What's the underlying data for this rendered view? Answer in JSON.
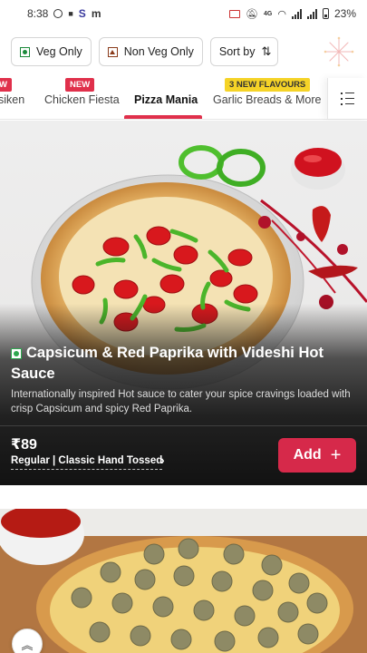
{
  "status_bar": {
    "time": "8:38",
    "battery": "23%",
    "network": "4G"
  },
  "filters": {
    "veg_label": "Veg Only",
    "nonveg_label": "Non Veg Only",
    "sort_label": "Sort by",
    "sort_icon": "⇅"
  },
  "tabs": {
    "items": [
      {
        "label": "siken",
        "badge": "W"
      },
      {
        "label": "Chicken Fiesta",
        "badge": "NEW"
      },
      {
        "label": "Pizza Mania",
        "badge": ""
      },
      {
        "label": "Garlic Breads & More",
        "badge": "3 NEW FLAVOURS"
      }
    ],
    "active_index": 2
  },
  "product": {
    "name": "Capsicum & Red Paprika with Videshi Hot Sauce",
    "description": "Internationally inspired Hot sauce to cater your spice cravings loaded with crisp Capsicum and spicy Red Paprika.",
    "price": "₹89",
    "size_crust": "Regular | Classic Hand Tossed",
    "size_chevron": "›",
    "add_label": "Add",
    "add_icon": "+"
  },
  "scroll_top_icon": "︽",
  "colors": {
    "accent": "#d6294a",
    "veg": "#1b8a3a",
    "badge_yellow": "#f5d327"
  }
}
